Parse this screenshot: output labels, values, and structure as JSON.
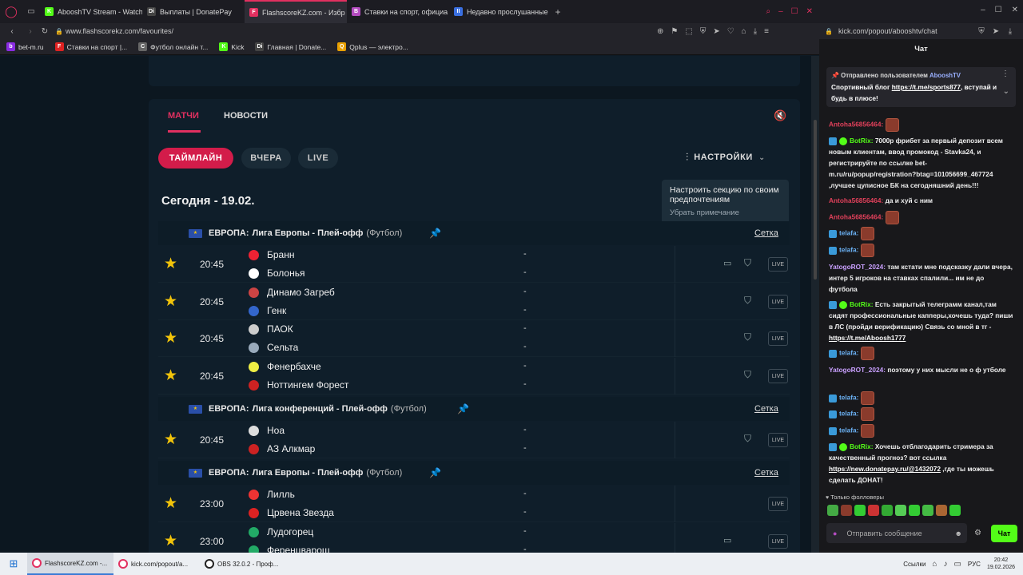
{
  "left_browser": {
    "tabs": [
      {
        "title": "AbooshTV Stream - Watch",
        "color": "#53fc18",
        "glyph": "K"
      },
      {
        "title": "Выплаты | DonatePay",
        "color": "#444444",
        "glyph": "Di"
      },
      {
        "title": "FlashscoreKZ.com - Избр",
        "color": "#e23060",
        "glyph": "F"
      },
      {
        "title": "Ставки на спорт, официа",
        "color": "#b44cc0",
        "glyph": "B"
      },
      {
        "title": "Недавно прослушанные",
        "color": "#3a6fe0",
        "glyph": "II"
      }
    ],
    "new_tab": "+",
    "url": "www.flashscorekz.com/favourites/",
    "bookmarks": [
      {
        "label": "bet-m.ru",
        "color": "#8a2be2",
        "glyph": "b"
      },
      {
        "label": "Ставки на спорт |...",
        "color": "#d22",
        "glyph": "F"
      },
      {
        "label": "Футбол онлайн т...",
        "color": "#666",
        "glyph": "C"
      },
      {
        "label": "Kick",
        "color": "#53fc18",
        "glyph": "K"
      },
      {
        "label": "Главная | Donate...",
        "color": "#444",
        "glyph": "Di"
      },
      {
        "label": "Qplus — электро...",
        "color": "#e8a000",
        "glyph": "Q"
      }
    ]
  },
  "flashscore": {
    "tabs": {
      "matches": "МАТЧИ",
      "news": "НОВОСТИ"
    },
    "filters": {
      "timeline": "ТАЙМЛАЙН",
      "yesterday": "ВЧЕРА",
      "live": "LIVE"
    },
    "settings_label": "НАСТРОЙКИ",
    "tooltip": {
      "text": "Настроить секцию по своим предпочтениям",
      "dismiss": "Убрать примечание"
    },
    "date_heading": "Сегодня - 19.02.",
    "grid_link": "Сетка",
    "live_label": "LIVE",
    "score_dash": "-",
    "leagues": [
      {
        "country": "ЕВРОПА:",
        "name": "Лига Европы - Плей-офф",
        "sport": "(Футбол)"
      },
      {
        "country": "ЕВРОПА:",
        "name": "Лига конференций - Плей-офф",
        "sport": "(Футбол)"
      },
      {
        "country": "ЕВРОПА:",
        "name": "Лига Европы - Плей-офф",
        "sport": "(Футбол)"
      }
    ],
    "matches": [
      {
        "time": "20:45",
        "home": "Бранн",
        "away": "Болонья",
        "tv": true
      },
      {
        "time": "20:45",
        "home": "Динамо Загреб",
        "away": "Генк",
        "tv": false
      },
      {
        "time": "20:45",
        "home": "ПАОК",
        "away": "Сельта",
        "tv": false
      },
      {
        "time": "20:45",
        "home": "Фенербахче",
        "away": "Ноттингем Форест",
        "tv": false
      },
      {
        "time": "20:45",
        "home": "Ноа",
        "away": "АЗ Алкмар",
        "tv": false
      },
      {
        "time": "23:00",
        "home": "Лилль",
        "away": "Црвена Звезда",
        "tv": false
      },
      {
        "time": "23:00",
        "home": "Лудогорец",
        "away": "Ференцварош",
        "tv": true
      }
    ]
  },
  "chat": {
    "url": "kick.com/popout/abooshtv/chat",
    "header": "Чат",
    "pinned": {
      "by_label": "Отправлено пользователем",
      "by_user": "AbooshTV",
      "text_before": "Спортивный блог ",
      "link": "https://t.me/sports877",
      "text_after": ", вступай и будь в плюсе!"
    },
    "messages": [
      {
        "user": "Antoha56856464:",
        "color": "#e0405a",
        "text": "",
        "emote": true
      },
      {
        "user": "BotRix:",
        "color": "#53fc18",
        "text": "7000р фрибет за первый депозит всем новым клиентам, ввод промокод - Stavka24, и регистрируйте по ссылке bet-m.ru/ru/popup/registration?btag=101056699_467724 ,лучшее цуписное БК на сегодняшний день!!!"
      },
      {
        "user": "Antoha56856464:",
        "color": "#e0405a",
        "text": "да и хуй с ним"
      },
      {
        "user": "Antoha56856464:",
        "color": "#e0405a",
        "text": "",
        "emote": true
      },
      {
        "user": "telafa:",
        "color": "#6ab0f3",
        "text": "",
        "emote": true
      },
      {
        "user": "telafa:",
        "color": "#6ab0f3",
        "text": "",
        "emote": true
      },
      {
        "user": "YatogoROT_2024:",
        "color": "#c9a0ff",
        "text": "там кстати мне подсказку дали вчера, интер 5 игроков на ставках спалили... им не до футбола"
      },
      {
        "user": "BotRix:",
        "color": "#53fc18",
        "text": "Есть закрытый телеграмм канал,там сидят профессиональные капперы,хочешь туда? пиши в ЛС (пройди верификацию) Связь со мной в тг - ",
        "link": "https://t.me/Aboosh1777"
      },
      {
        "user": "telafa:",
        "color": "#6ab0f3",
        "text": "",
        "emote": true
      },
      {
        "user": "YatogoROT_2024:",
        "color": "#c9a0ff",
        "text": "поэтому у них мысли не о ф утболе"
      },
      {
        "user": "telafa:",
        "color": "#6ab0f3",
        "text": "",
        "emote": true
      },
      {
        "user": "telafa:",
        "color": "#6ab0f3",
        "text": "",
        "emote": true
      },
      {
        "user": "telafa:",
        "color": "#6ab0f3",
        "text": "",
        "emote": true
      },
      {
        "user": "BotRix:",
        "color": "#53fc18",
        "text": "Хочешь отблагодарить стримера за качественный прогноз? вот ссылка ",
        "link": "https://new.donatepay.ru/@1432072",
        "text_after": " ,где ты можешь сделать ДОНАТ!"
      }
    ],
    "followers_only": "Только фолловеры",
    "input_placeholder": "Отправить сообщение",
    "send_label": "Чат"
  },
  "taskbar": {
    "apps": [
      {
        "label": "FlashscoreKZ.com -...",
        "color": "#e23060"
      },
      {
        "label": "kick.com/popout/a...",
        "color": "#e23060"
      },
      {
        "label": "OBS 32.0.2 - Проф...",
        "color": "#222"
      }
    ],
    "tray_links": "Ссылки",
    "lang": "РУС",
    "time": "20:42",
    "date": "19.02.2026"
  },
  "colors": {
    "accent": "#e23060",
    "star": "#f2c40a",
    "pin": "#2f8cff",
    "kick_green": "#53fc18"
  }
}
